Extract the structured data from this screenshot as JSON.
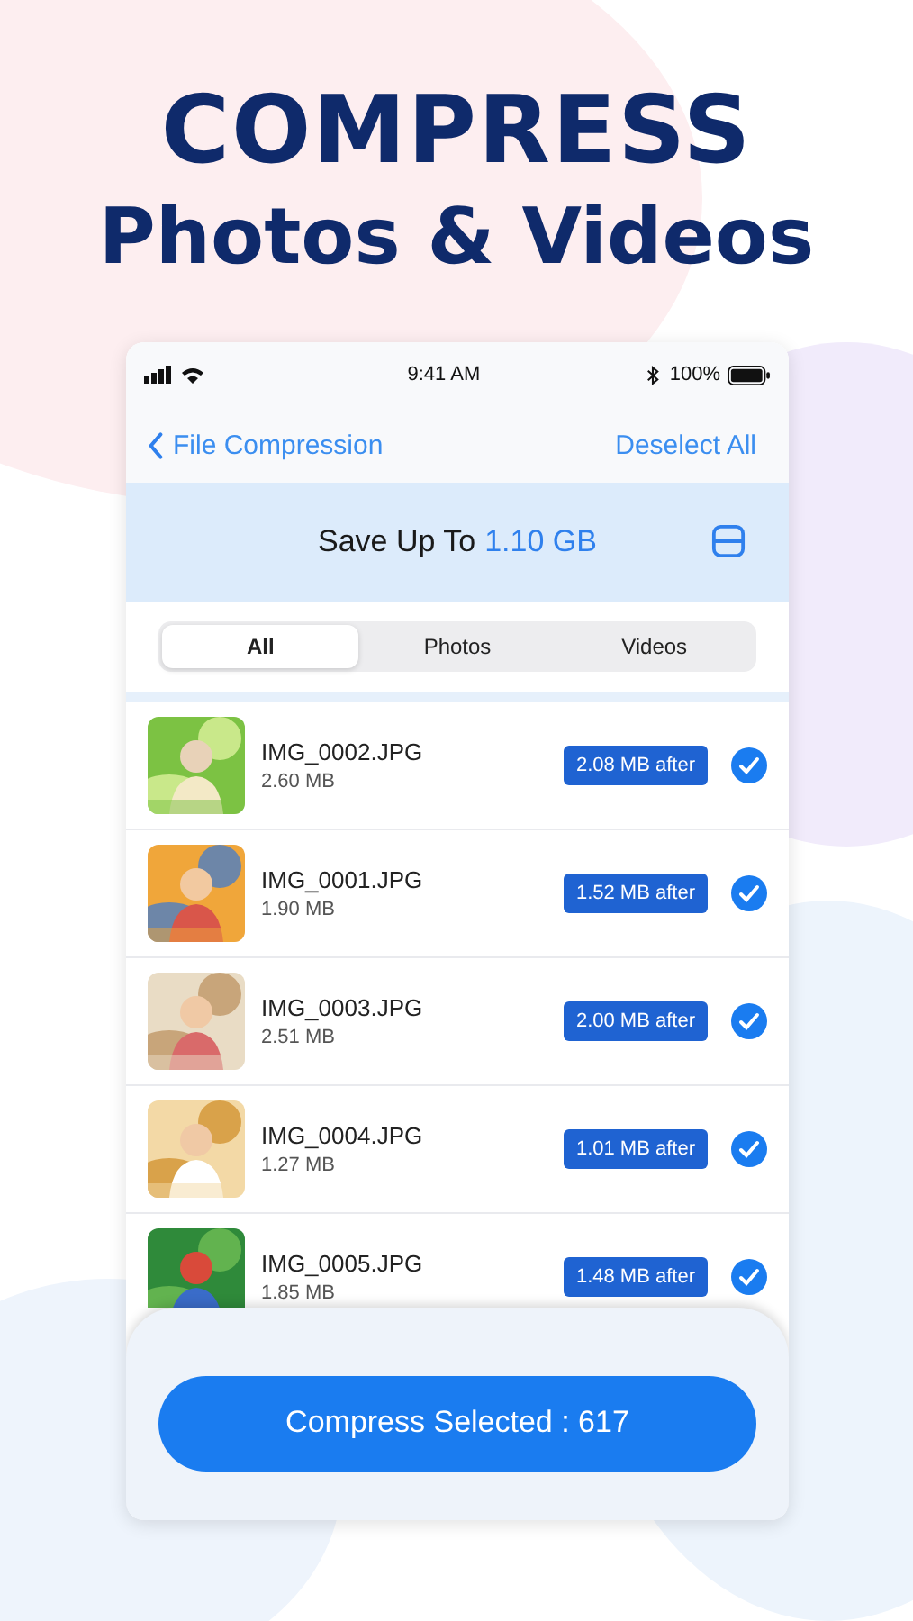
{
  "headline": [
    "COMPRESS",
    "Photos & Videos"
  ],
  "status_bar": {
    "time": "9:41 AM",
    "battery": "100%"
  },
  "nav": {
    "back": "File Compression",
    "action": "Deselect All"
  },
  "banner": {
    "label": "Save Up To",
    "amount": "1.10 GB"
  },
  "tabs": [
    {
      "label": "All",
      "selected": true
    },
    {
      "label": "Photos",
      "selected": false
    },
    {
      "label": "Videos",
      "selected": false
    }
  ],
  "files": [
    {
      "name": "IMG_0002.JPG",
      "size": "2.60 MB",
      "after": "2.08 MB after",
      "checked": true
    },
    {
      "name": "IMG_0001.JPG",
      "size": "1.90 MB",
      "after": "1.52 MB after",
      "checked": true
    },
    {
      "name": "IMG_0003.JPG",
      "size": "2.51 MB",
      "after": "2.00 MB after",
      "checked": true
    },
    {
      "name": "IMG_0004.JPG",
      "size": "1.27 MB",
      "after": "1.01 MB after",
      "checked": true
    },
    {
      "name": "IMG_0005.JPG",
      "size": "1.85 MB",
      "after": "1.48 MB after",
      "checked": true
    }
  ],
  "compress_button": "Compress Selected : 617"
}
